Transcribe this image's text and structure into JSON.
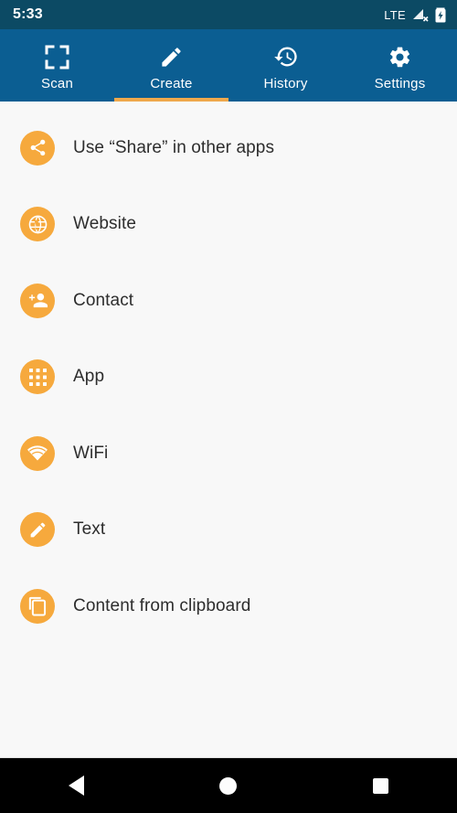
{
  "status_bar": {
    "time": "5:33",
    "network_label": "LTE",
    "signal_icon": "signal-no-service-icon",
    "battery_icon": "battery-charging-icon"
  },
  "tabs": {
    "active_index": 1,
    "indicator_color": "#efa84c",
    "bar_color": "#0b5e92",
    "items": [
      {
        "label": "Scan",
        "icon": "scan-viewfinder-icon"
      },
      {
        "label": "Create",
        "icon": "pencil-icon"
      },
      {
        "label": "History",
        "icon": "history-clock-icon"
      },
      {
        "label": "Settings",
        "icon": "gear-icon"
      }
    ]
  },
  "create_list": {
    "accent_color": "#f6a93d",
    "items": [
      {
        "label": "Use “Share” in other apps",
        "icon": "share-icon"
      },
      {
        "label": "Website",
        "icon": "globe-icon"
      },
      {
        "label": "Contact",
        "icon": "person-add-icon"
      },
      {
        "label": "App",
        "icon": "app-grid-icon"
      },
      {
        "label": "WiFi",
        "icon": "wifi-icon"
      },
      {
        "label": "Text",
        "icon": "pencil-icon"
      },
      {
        "label": "Content from clipboard",
        "icon": "copy-icon"
      }
    ]
  },
  "nav_bar": {
    "back": "back-triangle-icon",
    "home": "home-circle-icon",
    "recents": "recents-square-icon"
  }
}
